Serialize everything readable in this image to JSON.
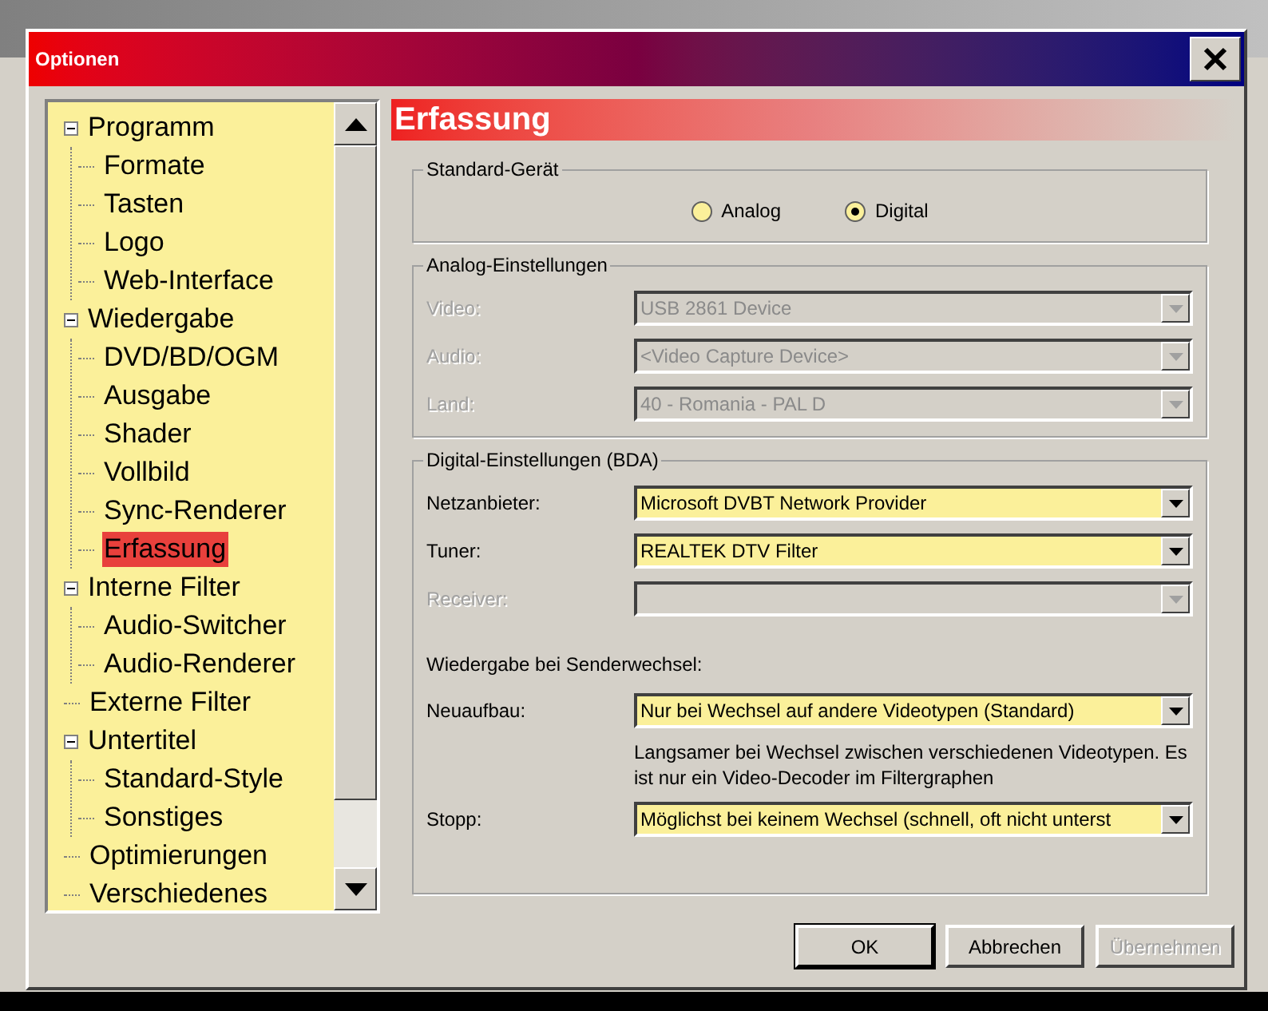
{
  "window": {
    "title": "Optionen"
  },
  "tree": [
    {
      "label": "Programm",
      "selected": false,
      "expanded": true,
      "children": [
        {
          "label": "Formate",
          "selected": false
        },
        {
          "label": "Tasten",
          "selected": false
        },
        {
          "label": "Logo",
          "selected": false
        },
        {
          "label": "Web-Interface",
          "selected": false
        }
      ]
    },
    {
      "label": "Wiedergabe",
      "selected": false,
      "expanded": true,
      "children": [
        {
          "label": "DVD/BD/OGM",
          "selected": false
        },
        {
          "label": "Ausgabe",
          "selected": false
        },
        {
          "label": "Shader",
          "selected": false
        },
        {
          "label": "Vollbild",
          "selected": false
        },
        {
          "label": "Sync-Renderer",
          "selected": false
        },
        {
          "label": "Erfassung",
          "selected": true
        }
      ]
    },
    {
      "label": "Interne Filter",
      "selected": false,
      "expanded": true,
      "children": [
        {
          "label": "Audio-Switcher",
          "selected": false
        },
        {
          "label": "Audio-Renderer",
          "selected": false
        }
      ]
    },
    {
      "label": "Externe Filter",
      "selected": false
    },
    {
      "label": "Untertitel",
      "selected": false,
      "expanded": true,
      "children": [
        {
          "label": "Standard-Style",
          "selected": false
        },
        {
          "label": "Sonstiges",
          "selected": false
        }
      ]
    },
    {
      "label": "Optimierungen",
      "selected": false
    },
    {
      "label": "Verschiedenes",
      "selected": false
    }
  ],
  "page_title": "Erfassung",
  "standard_device": {
    "title": "Standard-Gerät",
    "options": [
      {
        "label": "Analog",
        "selected": false
      },
      {
        "label": "Digital",
        "selected": true
      }
    ]
  },
  "analog": {
    "title": "Analog-Einstellungen",
    "fields": [
      {
        "label": "Video:",
        "value": "USB 2861 Device",
        "disabled": true
      },
      {
        "label": "Audio:",
        "value": "<Video Capture Device>",
        "disabled": true
      },
      {
        "label": "Land:",
        "value": "40 - Romania - PAL D",
        "disabled": true
      }
    ]
  },
  "digital": {
    "title": "Digital-Einstellungen (BDA)",
    "fields": [
      {
        "label": "Netzanbieter:",
        "value": "Microsoft DVBT Network Provider",
        "disabled": false
      },
      {
        "label": "Tuner:",
        "value": "REALTEK DTV Filter",
        "disabled": false
      },
      {
        "label": "Receiver:",
        "disabled": true
      }
    ],
    "switch_heading": "Wiedergabe bei Senderwechsel:",
    "rebuild": {
      "label": "Neuaufbau:",
      "value": "Nur bei Wechsel auf andere Videotypen (Standard)",
      "disabled": false
    },
    "rebuild_note": "Langsamer bei Wechsel zwischen verschiedenen Videotypen. Es ist nur ein Video-Decoder im Filtergraphen",
    "stop": {
      "label": "Stopp:",
      "value": "Möglichst bei keinem Wechsel (schnell, oft nicht unterst",
      "disabled": false
    }
  },
  "buttons": [
    {
      "label": "OK",
      "default": true,
      "disabled": false
    },
    {
      "label": "Abbrechen",
      "default": false,
      "disabled": false
    },
    {
      "label": "Übernehmen",
      "default": false,
      "disabled": true
    }
  ]
}
